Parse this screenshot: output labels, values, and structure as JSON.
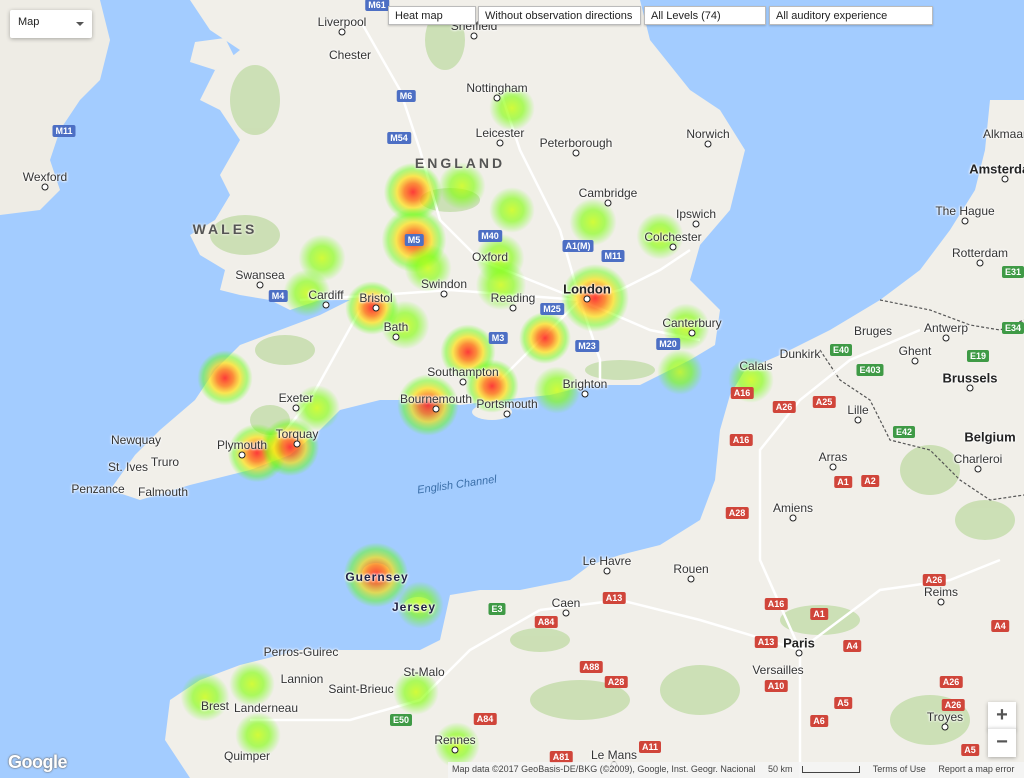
{
  "controls": {
    "map_type": "Map",
    "heat_map": "Heat map",
    "directions": "Without observation directions",
    "levels": "All Levels (74)",
    "experience": "All auditory experience",
    "zoom_in": "+",
    "zoom_out": "−"
  },
  "branding": {
    "logo": "Google"
  },
  "attribution": {
    "data": "Map data ©2017 GeoBasis-DE/BKG (©2009), Google, Inst. Geogr. Nacional",
    "scale": "50 km",
    "terms": "Terms of Use",
    "report": "Report a map error"
  },
  "colors": {
    "sea": "#a3ccff",
    "land": "#f1efe9",
    "park": "#c8deb0",
    "heat_low": "#5cff00",
    "heat_mid": "#ffd600",
    "heat_high": "#ff2020"
  },
  "places": [
    {
      "name": "Liverpool",
      "kind": "city"
    },
    {
      "name": "Sheffield",
      "kind": "city"
    },
    {
      "name": "Chester",
      "kind": "town"
    },
    {
      "name": "Nottingham",
      "kind": "city"
    },
    {
      "name": "Leicester",
      "kind": "city"
    },
    {
      "name": "Peterborough",
      "kind": "city"
    },
    {
      "name": "Norwich",
      "kind": "city"
    },
    {
      "name": "ENGLAND",
      "kind": "region"
    },
    {
      "name": "WALES",
      "kind": "region"
    },
    {
      "name": "Wexford",
      "kind": "town"
    },
    {
      "name": "Cambridge",
      "kind": "city"
    },
    {
      "name": "Ipswich",
      "kind": "city"
    },
    {
      "name": "Colchester",
      "kind": "town"
    },
    {
      "name": "Oxford",
      "kind": "city"
    },
    {
      "name": "Swansea",
      "kind": "city"
    },
    {
      "name": "Cardiff",
      "kind": "city"
    },
    {
      "name": "Swindon",
      "kind": "town"
    },
    {
      "name": "London",
      "kind": "capital"
    },
    {
      "name": "Reading",
      "kind": "town"
    },
    {
      "name": "Bristol",
      "kind": "city"
    },
    {
      "name": "Bath",
      "kind": "town"
    },
    {
      "name": "Canterbury",
      "kind": "town"
    },
    {
      "name": "Southampton",
      "kind": "city"
    },
    {
      "name": "Brighton",
      "kind": "city"
    },
    {
      "name": "Exeter",
      "kind": "city"
    },
    {
      "name": "Bournemouth",
      "kind": "town"
    },
    {
      "name": "Portsmouth",
      "kind": "city"
    },
    {
      "name": "Newquay",
      "kind": "town"
    },
    {
      "name": "Plymouth",
      "kind": "city"
    },
    {
      "name": "Torquay",
      "kind": "town"
    },
    {
      "name": "Truro",
      "kind": "town"
    },
    {
      "name": "St. Ives",
      "kind": "town"
    },
    {
      "name": "Penzance",
      "kind": "town"
    },
    {
      "name": "Falmouth",
      "kind": "town"
    },
    {
      "name": "English Channel",
      "kind": "sea"
    },
    {
      "name": "Guernsey",
      "kind": "island"
    },
    {
      "name": "Jersey",
      "kind": "island"
    },
    {
      "name": "Alkmaar",
      "kind": "town"
    },
    {
      "name": "Amsterdam",
      "kind": "capital"
    },
    {
      "name": "The Hague",
      "kind": "city"
    },
    {
      "name": "Rotterdam",
      "kind": "city"
    },
    {
      "name": "Bruges",
      "kind": "town"
    },
    {
      "name": "Antwerp",
      "kind": "city"
    },
    {
      "name": "Ghent",
      "kind": "city"
    },
    {
      "name": "Dunkirk",
      "kind": "town"
    },
    {
      "name": "Calais",
      "kind": "town"
    },
    {
      "name": "Brussels",
      "kind": "capital"
    },
    {
      "name": "Lille",
      "kind": "city"
    },
    {
      "name": "Belgium",
      "kind": "country"
    },
    {
      "name": "Arras",
      "kind": "town"
    },
    {
      "name": "Charleroi",
      "kind": "city"
    },
    {
      "name": "Amiens",
      "kind": "city"
    },
    {
      "name": "Le Havre",
      "kind": "city"
    },
    {
      "name": "Rouen",
      "kind": "city"
    },
    {
      "name": "Caen",
      "kind": "city"
    },
    {
      "name": "Reims",
      "kind": "city"
    },
    {
      "name": "Paris",
      "kind": "capital"
    },
    {
      "name": "Versailles",
      "kind": "town"
    },
    {
      "name": "Perros-Guirec",
      "kind": "town"
    },
    {
      "name": "Lannion",
      "kind": "town"
    },
    {
      "name": "St-Malo",
      "kind": "town"
    },
    {
      "name": "Saint-Brieuc",
      "kind": "town"
    },
    {
      "name": "Brest",
      "kind": "city"
    },
    {
      "name": "Landerneau",
      "kind": "town"
    },
    {
      "name": "Quimper",
      "kind": "town"
    },
    {
      "name": "Rennes",
      "kind": "city"
    },
    {
      "name": "Le Mans",
      "kind": "city"
    },
    {
      "name": "Troyes",
      "kind": "city"
    }
  ],
  "roads": [
    "M61",
    "M6",
    "M54",
    "M11",
    "M4",
    "M5",
    "M40",
    "A1(M)",
    "M11",
    "M25",
    "M3",
    "M23",
    "M20",
    "A16",
    "A26",
    "A25",
    "E40",
    "E403",
    "E19",
    "E34",
    "E42",
    "A16",
    "A1",
    "A2",
    "A28",
    "E3",
    "A13",
    "A84",
    "A16",
    "A26",
    "A1",
    "A13",
    "A4",
    "A88",
    "A28",
    "E50",
    "A84",
    "A81",
    "A11",
    "A10",
    "A5",
    "A6",
    "A26",
    "A4",
    "A5",
    "A26",
    "E31"
  ],
  "heat_points": [
    {
      "place": "Nottingham",
      "intensity": 0.3
    },
    {
      "place": "Shropshire",
      "intensity": 0.7
    },
    {
      "place": "Malvern",
      "intensity": 0.9
    },
    {
      "place": "Coventry",
      "intensity": 0.35
    },
    {
      "place": "Oxford",
      "intensity": 0.4
    },
    {
      "place": "Cambridge",
      "intensity": 0.35
    },
    {
      "place": "Bedford",
      "intensity": 0.3
    },
    {
      "place": "Colchester",
      "intensity": 0.35
    },
    {
      "place": "Cardiff",
      "intensity": 0.35
    },
    {
      "place": "Brecon",
      "intensity": 0.35
    },
    {
      "place": "Bristol",
      "intensity": 0.55
    },
    {
      "place": "Bath",
      "intensity": 0.4
    },
    {
      "place": "Swindon",
      "intensity": 0.35
    },
    {
      "place": "Reading",
      "intensity": 0.45
    },
    {
      "place": "London",
      "intensity": 1.0
    },
    {
      "place": "Guildford",
      "intensity": 0.5
    },
    {
      "place": "Canterbury",
      "intensity": 0.35
    },
    {
      "place": "Southampton",
      "intensity": 0.6
    },
    {
      "place": "Portsmouth",
      "intensity": 0.55
    },
    {
      "place": "Brighton",
      "intensity": 0.35
    },
    {
      "place": "Eastbourne",
      "intensity": 0.3
    },
    {
      "place": "Bournemouth",
      "intensity": 0.8
    },
    {
      "place": "Exeter",
      "intensity": 0.3
    },
    {
      "place": "North Devon",
      "intensity": 0.6
    },
    {
      "place": "Plymouth",
      "intensity": 0.7
    },
    {
      "place": "Torquay",
      "intensity": 0.7
    },
    {
      "place": "Calais",
      "intensity": 0.3
    },
    {
      "place": "Guernsey",
      "intensity": 0.9
    },
    {
      "place": "Jersey",
      "intensity": 0.35
    },
    {
      "place": "Brest",
      "intensity": 0.4
    },
    {
      "place": "Morlaix",
      "intensity": 0.3
    },
    {
      "place": "Quimper",
      "intensity": 0.3
    },
    {
      "place": "Dinan",
      "intensity": 0.3
    },
    {
      "place": "Rennes",
      "intensity": 0.3
    }
  ]
}
